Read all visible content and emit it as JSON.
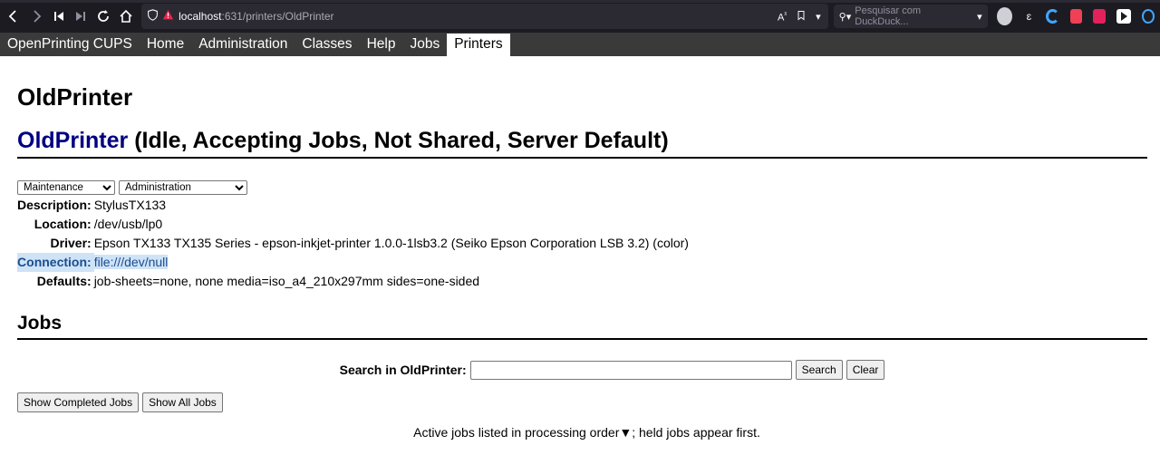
{
  "browser": {
    "url_host": "localhost",
    "url_path": ":631/printers/OldPrinter",
    "search_placeholder": "Pesquisar com DuckDuck...",
    "translate_label": "A̶",
    "colors": {
      "chrome_bg": "#1c1b22",
      "urlbar_bg": "#2b2a33",
      "warning": "#e22850"
    }
  },
  "nav": {
    "items": [
      {
        "label": "OpenPrinting CUPS",
        "active": false
      },
      {
        "label": "Home",
        "active": false
      },
      {
        "label": "Administration",
        "active": false
      },
      {
        "label": "Classes",
        "active": false
      },
      {
        "label": "Help",
        "active": false
      },
      {
        "label": "Jobs",
        "active": false
      },
      {
        "label": "Printers",
        "active": true
      }
    ]
  },
  "page": {
    "title": "OldPrinter",
    "printer_link": "OldPrinter",
    "printer_status": " (Idle, Accepting Jobs, Not Shared, Server Default)",
    "maintenance_select": "Maintenance",
    "administration_select": "Administration",
    "info": {
      "description_label": "Description:",
      "description_value": "StylusTX133",
      "location_label": "Location:",
      "location_value": "/dev/usb/lp0",
      "driver_label": "Driver:",
      "driver_value": "Epson TX133 TX135 Series - epson-inkjet-printer 1.0.0-1lsb3.2 (Seiko Epson Corporation LSB 3.2) (color)",
      "connection_label": "Connection:",
      "connection_value": "file:///dev/null",
      "defaults_label": "Defaults:",
      "defaults_value": "job-sheets=none, none media=iso_a4_210x297mm sides=one-sided"
    }
  },
  "jobs": {
    "heading": "Jobs",
    "search_label": "Search in OldPrinter:",
    "search_value": "",
    "search_button": "Search",
    "clear_button": "Clear",
    "show_completed_button": "Show Completed Jobs",
    "show_all_button": "Show All Jobs",
    "active_note": "Active jobs listed in processing order▼; held jobs appear first."
  }
}
